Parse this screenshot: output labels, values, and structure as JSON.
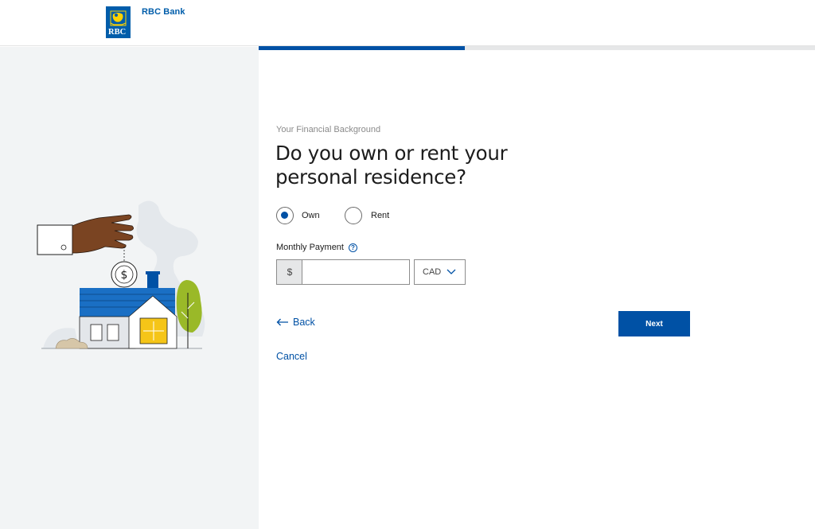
{
  "header": {
    "brand_name": "RBC Bank",
    "logo_text": "RBC"
  },
  "progress": {
    "fraction": 0.37
  },
  "form": {
    "section_label": "Your Financial Background",
    "question": "Do you own or rent your personal residence?",
    "residence_options": [
      {
        "label": "Own",
        "selected": true
      },
      {
        "label": "Rent",
        "selected": false
      }
    ],
    "monthly_payment": {
      "label": "Monthly Payment",
      "help_glyph": "?",
      "prefix": "$",
      "value": "",
      "currency": "CAD"
    }
  },
  "actions": {
    "back_label": "Back",
    "next_label": "Next",
    "cancel_label": "Cancel"
  },
  "colors": {
    "primary": "#0051a5",
    "left_panel": "#f2f4f5",
    "logo_gold": "#ffd200"
  },
  "icons": {
    "logo": "rbc-lion-logo-icon",
    "help": "help-circle-icon",
    "currency_dropdown": "chevron-down-icon",
    "back": "arrow-left-icon"
  }
}
